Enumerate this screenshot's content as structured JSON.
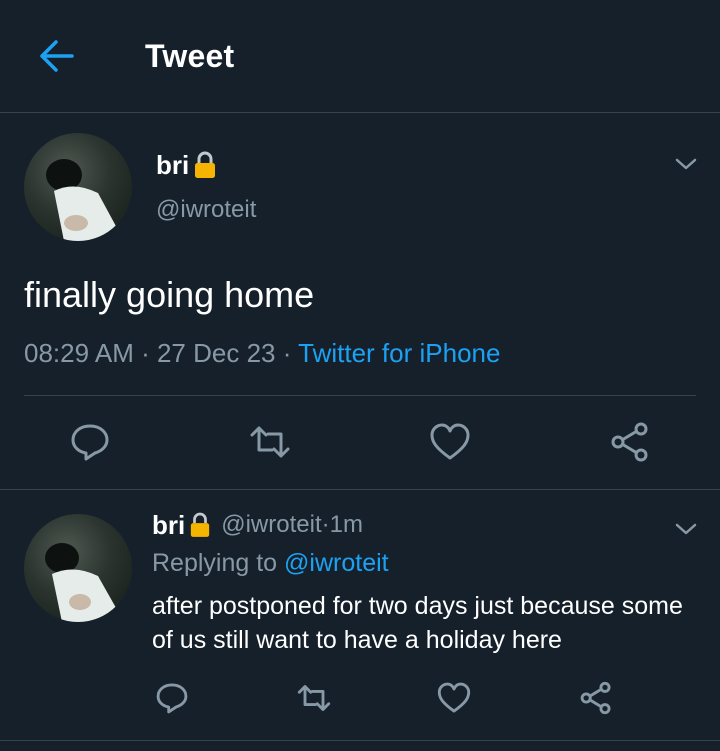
{
  "header": {
    "title": "Tweet",
    "back_icon": "arrow-left-icon"
  },
  "colors": {
    "background": "#15202b",
    "accent": "#1da1f2",
    "muted": "#8899a6",
    "divider": "#38444d"
  },
  "tweet": {
    "name": "bri",
    "handle": "@iwroteit",
    "text": "finally going home",
    "time": "08:29 AM",
    "date": "27 Dec 23",
    "separator": " · ",
    "source": "Twitter for iPhone",
    "actions": [
      "reply-icon",
      "retweet-icon",
      "like-icon",
      "share-icon"
    ]
  },
  "reply": {
    "name": "bri",
    "handle": "@iwroteit",
    "dot": " · ",
    "age": "1m",
    "replying_prefix": "Replying to ",
    "replying_to": "@iwroteit",
    "text": "after postponed for two days just because some of us still want to have a holiday here"
  }
}
